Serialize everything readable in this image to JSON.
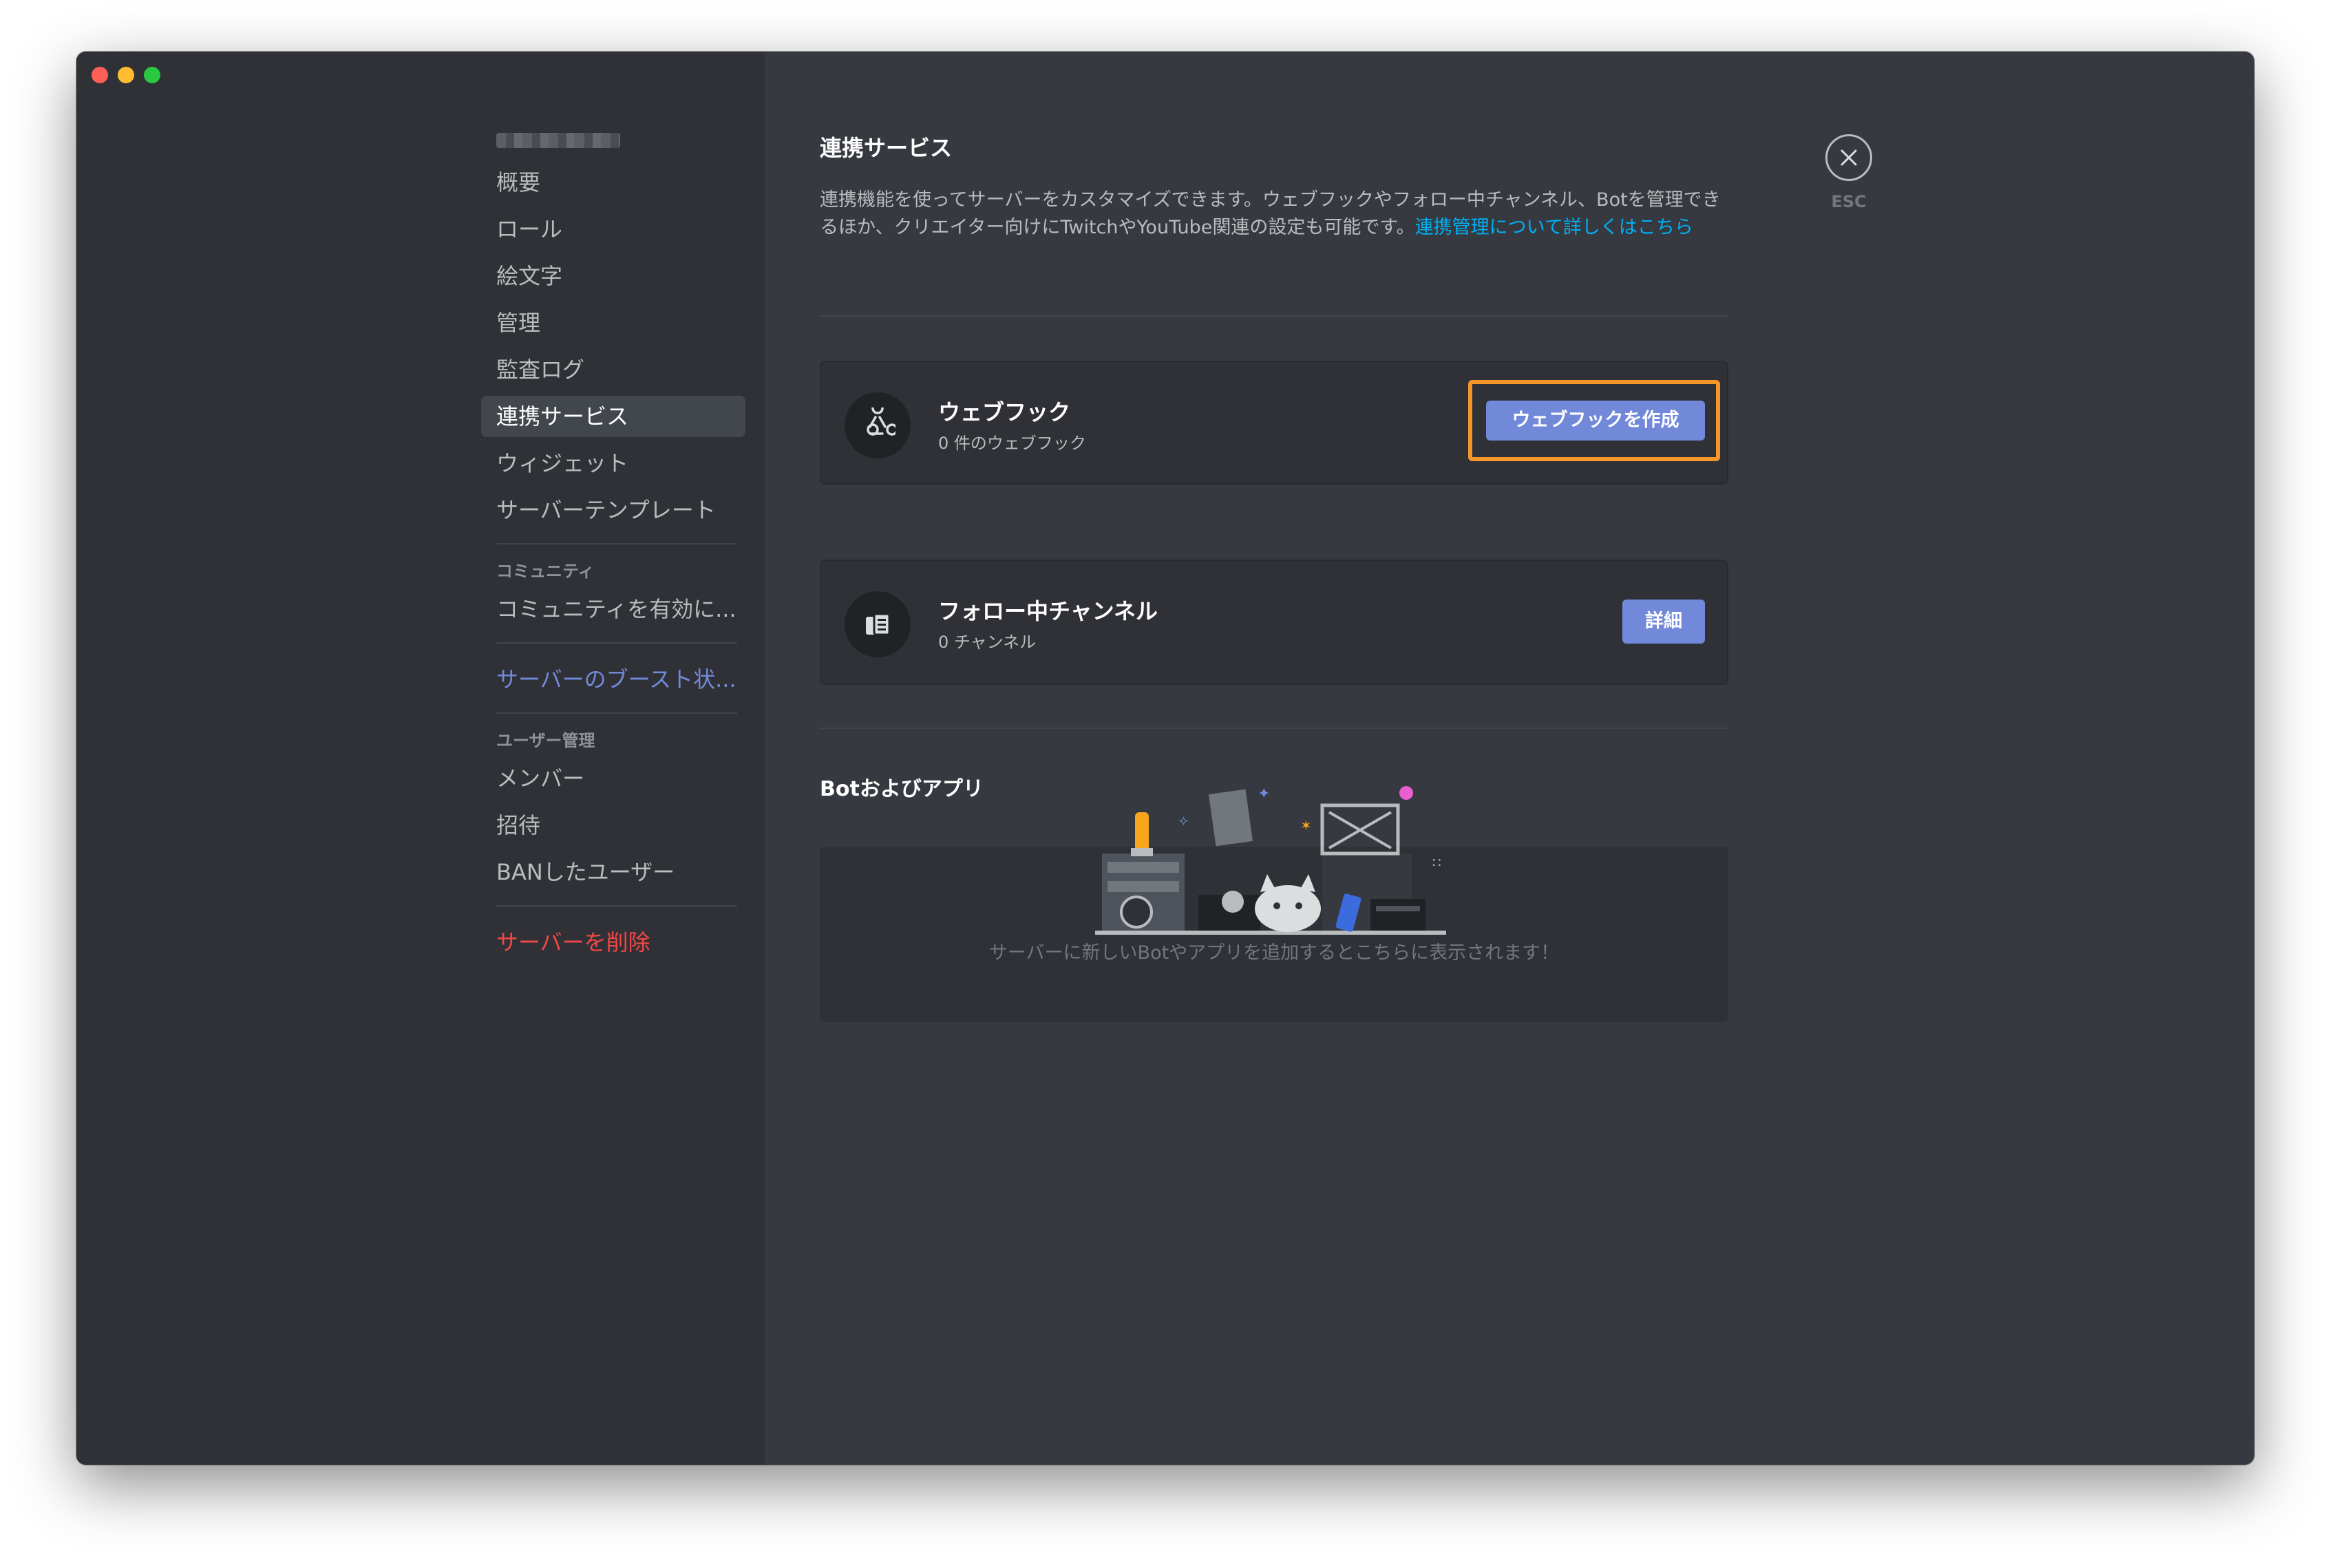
{
  "sidebar": {
    "items": [
      {
        "label": "概要",
        "style": "normal"
      },
      {
        "label": "ロール",
        "style": "normal"
      },
      {
        "label": "絵文字",
        "style": "normal"
      },
      {
        "label": "管理",
        "style": "normal"
      },
      {
        "label": "監査ログ",
        "style": "normal"
      },
      {
        "label": "連携サービス",
        "style": "selected"
      },
      {
        "label": "ウィジェット",
        "style": "normal"
      },
      {
        "label": "サーバーテンプレート",
        "style": "normal"
      }
    ],
    "community_header": "コミュニティ",
    "community_item": "コミュニティを有効に...",
    "boost_item": "サーバーのブースト状...",
    "user_mgmt_header": "ユーザー管理",
    "user_items": [
      "メンバー",
      "招待",
      "BANしたユーザー"
    ],
    "delete_item": "サーバーを削除"
  },
  "main": {
    "title": "連携サービス",
    "description": "連携機能を使ってサーバーをカスタマイズできます。ウェブフックやフォロー中チャンネル、Botを管理できるほか、クリエイター向けにTwitchやYouTube関連の設定も可能です。",
    "description_link": "連携管理について詳しくはこちら",
    "webhook": {
      "title": "ウェブフック",
      "subtitle": "0 件のウェブフック",
      "button": "ウェブフックを作成",
      "icon": "webhook-icon"
    },
    "followed": {
      "title": "フォロー中チャンネル",
      "subtitle": "0 チャンネル",
      "button": "詳細",
      "icon": "announcement-icon"
    },
    "bots_title": "Botおよびアプリ",
    "bots_empty": "サーバーに新しいBotやアプリを追加するとこちらに表示されます！"
  },
  "close": {
    "esc_label": "ESC"
  },
  "colors": {
    "accent": "#7289da",
    "link": "#00b0f4",
    "danger": "#f04747",
    "highlight": "#f5962a"
  }
}
